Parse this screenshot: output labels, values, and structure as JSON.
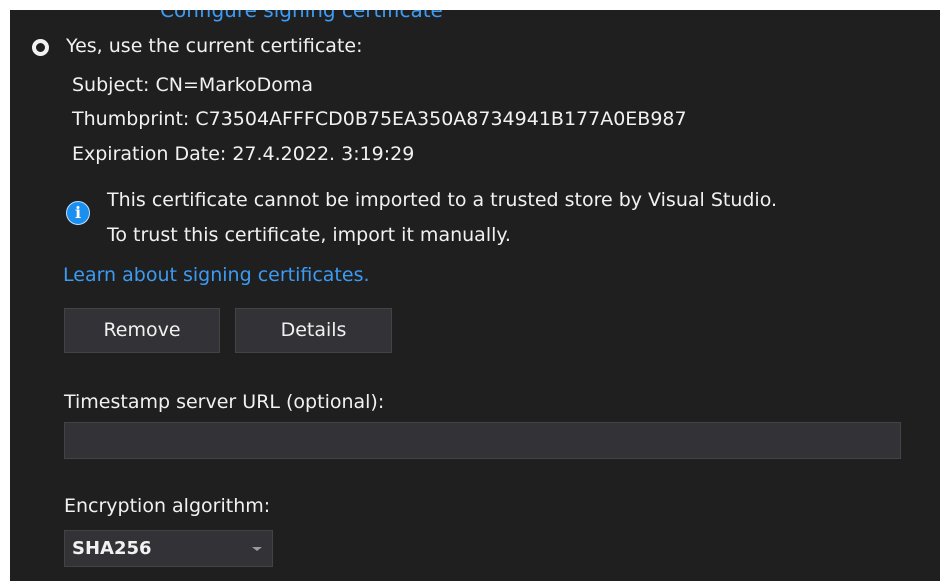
{
  "top_link_partial": "Configure signing certificate",
  "signing": {
    "option_label": "Yes, use the current certificate:",
    "subject": "Subject: CN=MarkoDoma",
    "thumbprint": "Thumbprint: C73504AFFFCD0B75EA350A8734941B177A0EB987",
    "expiration": "Expiration Date: 27.4.2022. 3:19:29"
  },
  "info": {
    "icon": "info-icon",
    "icon_glyph": "i",
    "line1": "This certificate cannot be imported to a trusted store by Visual Studio.",
    "line2": "To trust this certificate, import it manually."
  },
  "learn_link": "Learn about signing certificates.",
  "buttons": {
    "remove": "Remove",
    "details": "Details"
  },
  "timestamp": {
    "label": "Timestamp server URL (optional):",
    "value": ""
  },
  "encryption": {
    "label": "Encryption algorithm:",
    "selected": "SHA256"
  },
  "colors": {
    "background": "#1f1f1f",
    "text": "#f1f1f1",
    "link": "#3c9bf3",
    "info_icon": "#1b8ff0",
    "control": "#333337"
  }
}
